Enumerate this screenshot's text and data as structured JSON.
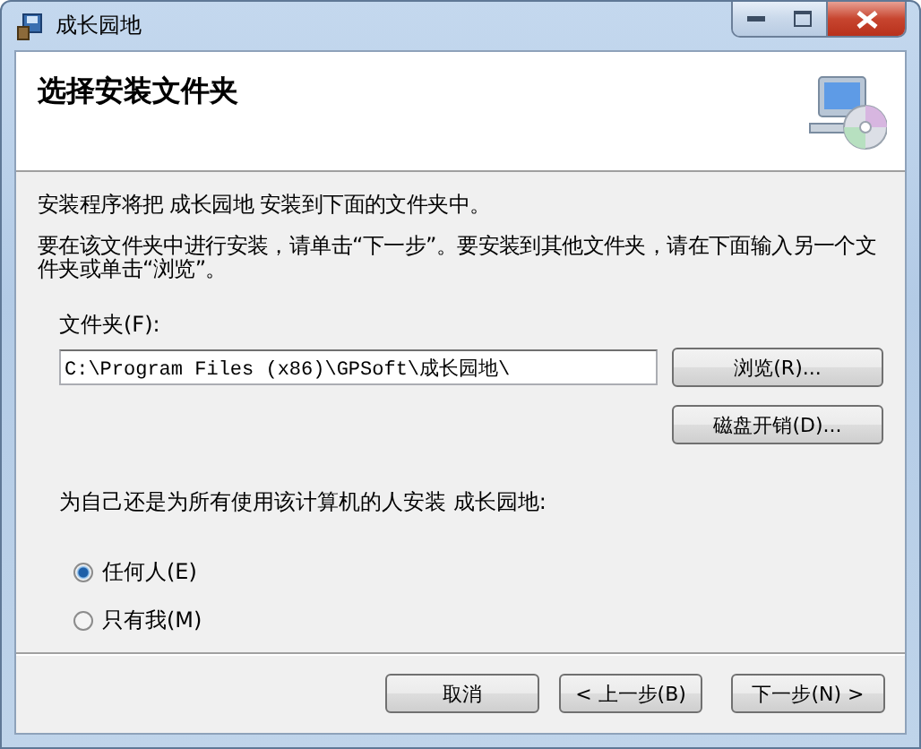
{
  "window": {
    "title": "成长园地"
  },
  "header": {
    "title": "选择安装文件夹"
  },
  "intro": "安装程序将把 成长园地 安装到下面的文件夹中。",
  "instructions": "要在该文件夹中进行安装，请单击“下一步”。要安装到其他文件夹，请在下面输入另一个文件夹或单击“浏览”。",
  "folder": {
    "label": "文件夹(F):",
    "value": "C:\\Program Files (x86)\\GPSoft\\成长园地\\"
  },
  "side_buttons": [
    "浏览(R)...",
    "磁盘开销(D)..."
  ],
  "question": "为自己还是为所有使用该计算机的人安装 成长园地:",
  "options": [
    {
      "label": "任何人(E)",
      "selected": true
    },
    {
      "label": "只有我(M)",
      "selected": false
    }
  ],
  "footer_buttons": [
    "取消",
    "< 上一步(B)",
    "下一步(N) >"
  ]
}
